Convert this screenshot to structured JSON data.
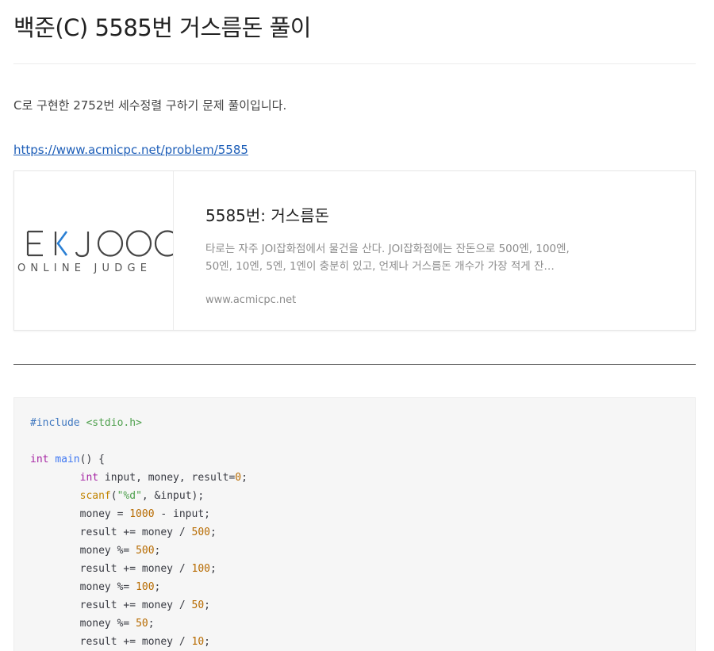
{
  "post": {
    "title": "백준(C) 5585번 거스름돈 풀이",
    "intro": "C로 구현한 2752번 세수정렬 구하기 문제 풀이입니다.",
    "link_text": "https://www.acmicpc.net/problem/5585"
  },
  "og_card": {
    "thumb_logo_text": "EKJOO",
    "thumb_logo_subtext": "ONLINE JUDGE",
    "title": "5585번: 거스름돈",
    "description": "타로는 자주 JOI잡화점에서 물건을 산다. JOI잡화점에는 잔돈으로 500엔, 100엔, 50엔, 10엔, 5엔, 1엔이 충분히 있고, 언제나 거스름돈 개수가 가장 적게 잔…",
    "domain": "www.acmicpc.net"
  },
  "code": {
    "lines": [
      [
        {
          "t": "#include ",
          "c": "include"
        },
        {
          "t": "<stdio.h>",
          "c": "str"
        }
      ],
      [],
      [
        {
          "t": "int",
          "c": "kw"
        },
        {
          "t": " ",
          "c": "plain"
        },
        {
          "t": "main",
          "c": "fn"
        },
        {
          "t": "() {",
          "c": "plain"
        }
      ],
      [
        {
          "t": "        ",
          "c": "plain"
        },
        {
          "t": "int",
          "c": "kw"
        },
        {
          "t": " input, money, result=",
          "c": "plain"
        },
        {
          "t": "0",
          "c": "num"
        },
        {
          "t": ";",
          "c": "plain"
        }
      ],
      [
        {
          "t": "        ",
          "c": "plain"
        },
        {
          "t": "scanf",
          "c": "builtin"
        },
        {
          "t": "(",
          "c": "plain"
        },
        {
          "t": "\"%d\"",
          "c": "str"
        },
        {
          "t": ", &input);",
          "c": "plain"
        }
      ],
      [
        {
          "t": "        money = ",
          "c": "plain"
        },
        {
          "t": "1000",
          "c": "num"
        },
        {
          "t": " - input;",
          "c": "plain"
        }
      ],
      [
        {
          "t": "        result += money / ",
          "c": "plain"
        },
        {
          "t": "500",
          "c": "num"
        },
        {
          "t": ";",
          "c": "plain"
        }
      ],
      [
        {
          "t": "        money %= ",
          "c": "plain"
        },
        {
          "t": "500",
          "c": "num"
        },
        {
          "t": ";",
          "c": "plain"
        }
      ],
      [
        {
          "t": "        result += money / ",
          "c": "plain"
        },
        {
          "t": "100",
          "c": "num"
        },
        {
          "t": ";",
          "c": "plain"
        }
      ],
      [
        {
          "t": "        money %= ",
          "c": "plain"
        },
        {
          "t": "100",
          "c": "num"
        },
        {
          "t": ";",
          "c": "plain"
        }
      ],
      [
        {
          "t": "        result += money / ",
          "c": "plain"
        },
        {
          "t": "50",
          "c": "num"
        },
        {
          "t": ";",
          "c": "plain"
        }
      ],
      [
        {
          "t": "        money %= ",
          "c": "plain"
        },
        {
          "t": "50",
          "c": "num"
        },
        {
          "t": ";",
          "c": "plain"
        }
      ],
      [
        {
          "t": "        result += money / ",
          "c": "plain"
        },
        {
          "t": "10",
          "c": "num"
        },
        {
          "t": ";",
          "c": "plain"
        }
      ]
    ]
  },
  "colors": {
    "link": "#1d5eb8",
    "logo_dark": "#444444",
    "logo_accent": "#2a7fd4",
    "code_bg": "#f6f6f6"
  }
}
